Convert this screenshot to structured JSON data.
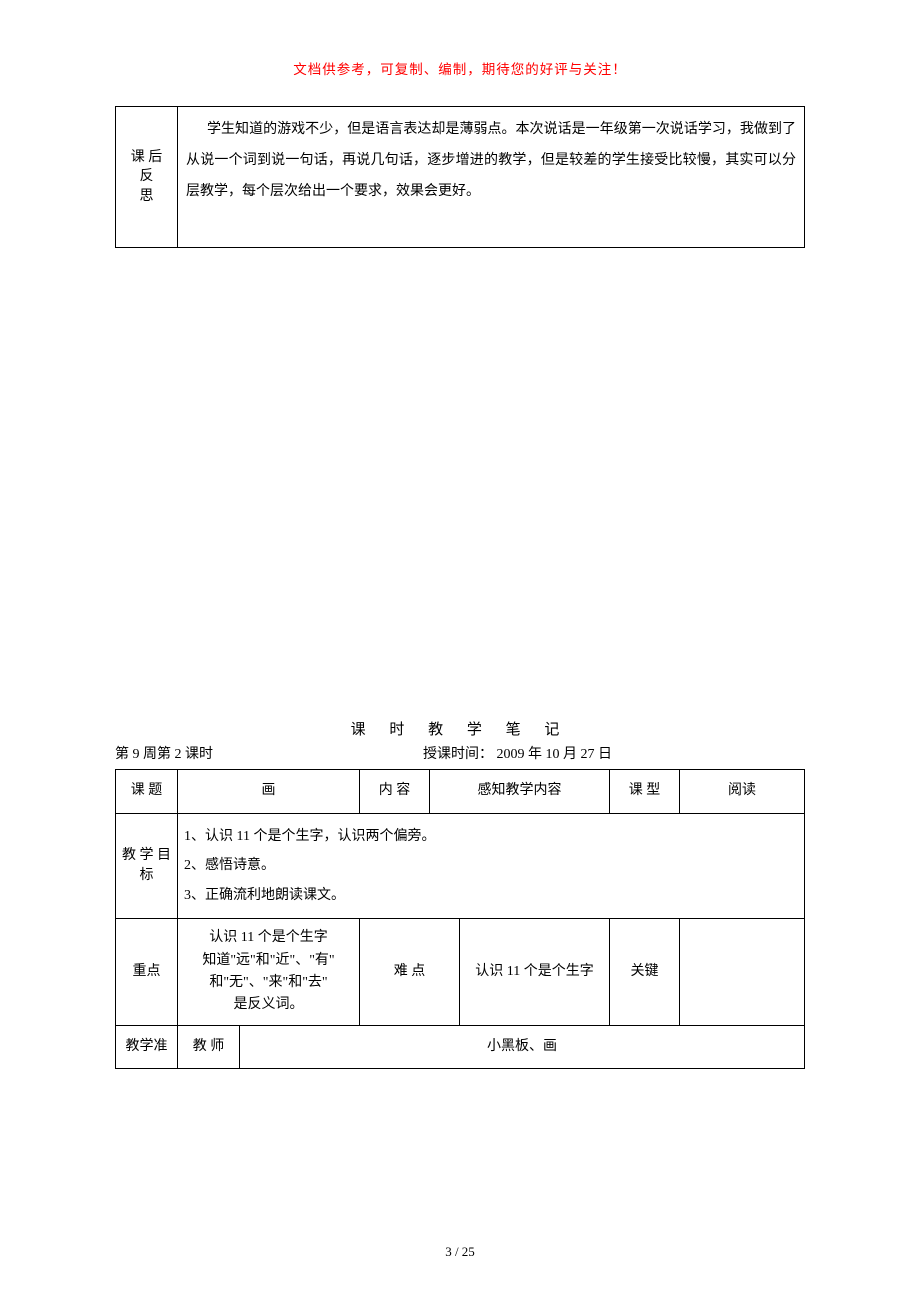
{
  "header_note": "文档供参考，可复制、编制，期待您的好评与关注！",
  "table1": {
    "row_label_l1": "课 后 反",
    "row_label_l2": "思",
    "reflection": "学生知道的游戏不少，但是语言表达却是薄弱点。本次说话是一年级第一次说话学习，我做到了从说一个词到说一句话，再说几句话，逐步增进的教学，但是较差的学生接受比较慢，其实可以分层教学，每个层次给出一个要求，效果会更好。"
  },
  "section_title": "课  时  教  学  笔  记",
  "meta": {
    "left": "第 9 周第 2 课时",
    "right_label": "授课时间：",
    "right_value": " 2009 年 10 月 27 日"
  },
  "table2": {
    "topic_label": "课 题",
    "topic_value": "画",
    "content_label": "内 容",
    "content_value": "感知教学内容",
    "type_label": "课 型",
    "type_value": "阅读",
    "goals_label_l1": "教 学 目",
    "goals_label_l2": "标",
    "goals_1": "1、认识 11 个是个生字，认识两个偏旁。",
    "goals_2": "2、感悟诗意。",
    "goals_3": "3、正确流利地朗读课文。",
    "keypoint_label": "重点",
    "keypoint_l1": "认识 11 个是个生字",
    "keypoint_l2": "知道\"远\"和\"近\"、\"有\"",
    "keypoint_l3": "和\"无\"、\"来\"和\"去\"",
    "keypoint_l4": "是反义词。",
    "difficulty_label": "难 点",
    "difficulty_value": "认识 11 个是个生字",
    "key_label": "关键",
    "key_value": "",
    "prep_label": "教学准",
    "teacher_label": "教 师",
    "teacher_value": "小黑板、画"
  },
  "footer": "3 / 25"
}
